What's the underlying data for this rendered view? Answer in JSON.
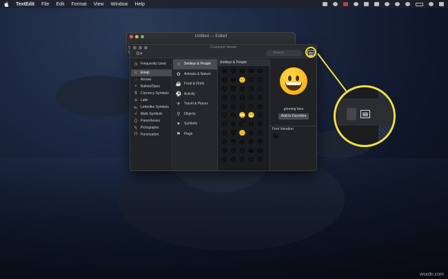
{
  "menubar": {
    "app_name": "TextEdit",
    "items": [
      "File",
      "Edit",
      "Format",
      "View",
      "Window",
      "Help"
    ]
  },
  "textedit_window": {
    "title": "Untitled — Edited",
    "side_text": [
      "T",
      "V"
    ]
  },
  "character_viewer": {
    "title": "Character Viewer",
    "search_placeholder": "Search",
    "categories": [
      {
        "label": "Frequently Used",
        "icon": "clock-icon",
        "glyph": "◷"
      },
      {
        "label": "Emoji",
        "icon": "emoji-icon",
        "glyph": "☺",
        "selected": true
      },
      {
        "label": "Arrows",
        "icon": "arrow-icon",
        "glyph": "→"
      },
      {
        "label": "Bullets/Stars",
        "icon": "bullet-icon",
        "glyph": "•"
      },
      {
        "label": "Currency Symbols",
        "icon": "currency-icon",
        "glyph": "$"
      },
      {
        "label": "Latin",
        "icon": "latin-icon",
        "glyph": "a"
      },
      {
        "label": "Letterlike Symbols",
        "icon": "letterlike-icon",
        "glyph": "℡"
      },
      {
        "label": "Math Symbols",
        "icon": "math-icon",
        "glyph": "√"
      },
      {
        "label": "Parentheses",
        "icon": "parentheses-icon",
        "glyph": "()"
      },
      {
        "label": "Pictographs",
        "icon": "pictograph-icon",
        "glyph": "✎"
      },
      {
        "label": "Punctuation",
        "icon": "punctuation-icon",
        "glyph": "!?"
      }
    ],
    "subcategories": [
      {
        "label": "Smileys & People",
        "icon": "smiley-icon",
        "glyph": "☺",
        "selected": true
      },
      {
        "label": "Animals & Nature",
        "icon": "animal-icon",
        "glyph": "✿"
      },
      {
        "label": "Food & Drink",
        "icon": "food-icon",
        "glyph": "☕"
      },
      {
        "label": "Activity",
        "icon": "activity-icon",
        "glyph": "⚽"
      },
      {
        "label": "Travel & Places",
        "icon": "travel-icon",
        "glyph": "✈"
      },
      {
        "label": "Objects",
        "icon": "objects-icon",
        "glyph": "⚲"
      },
      {
        "label": "Symbols",
        "icon": "symbols-icon",
        "glyph": "♥"
      },
      {
        "label": "Flags",
        "icon": "flag-icon",
        "glyph": "⚑"
      }
    ],
    "emoji_header": "Smileys & People",
    "emojis": [
      "😀",
      "😃",
      "😄",
      "😁",
      "😆",
      "😅",
      "😂",
      "🙂",
      "🙃",
      "😉",
      "😊",
      "😇",
      "😍",
      "😘",
      "😗",
      "😙",
      "😚",
      "😋",
      "😛",
      "😜",
      "😝",
      "😐",
      "😑",
      "😶",
      "😎",
      "😏",
      "😒",
      "🙄",
      "😬",
      "😌",
      "😔",
      "😪",
      "😴",
      "😷",
      "😵",
      "😕",
      "😟",
      "🙁",
      "😮",
      "😯",
      "😲",
      "😳",
      "😦",
      "😧",
      "😨",
      "😰",
      "😥",
      "😢",
      "😭",
      "😱",
      "😖",
      "😣",
      "😞",
      "😓",
      "😩"
    ],
    "detail": {
      "character_name": "grinning face",
      "favorites_button": "Add to Favorites",
      "font_variation_header": "Font Variation",
      "font_variation_sample": "😀"
    }
  },
  "watermark": "wsxdn.com",
  "colors": {
    "highlight_ring": "#f2e23b"
  }
}
